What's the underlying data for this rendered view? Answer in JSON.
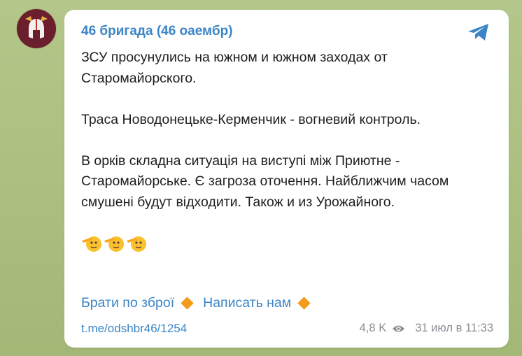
{
  "channel": {
    "name": "46 бригада (46 оаембр)",
    "avatar_icon": "spartan-helmet-icon",
    "avatar_color": "#6b1f2c"
  },
  "post": {
    "paragraphs": [
      "ЗСУ просунулись на южном и южном заходах от Старомайорского.",
      "Траса Новодонецьке-Керменчик - вогневий контроль.",
      "В орків складна ситуація на виступі між Приютне - Старомайорське. Є загроза оточення. Найближчим часом смушені будут відходити. Також и из Урожайного."
    ],
    "emoji_name": "saluting-face-emoji",
    "emoji_count": 3
  },
  "links": {
    "join": "Брати по зброї",
    "write": "Написать нам"
  },
  "footer": {
    "post_link": "t.me/odshbr46/1254",
    "views": "4,8 K",
    "date": "31 июл в 11:33"
  },
  "colors": {
    "link": "#3b85c6",
    "diamond": "#f29b1d",
    "background": "#a9bd7e"
  }
}
